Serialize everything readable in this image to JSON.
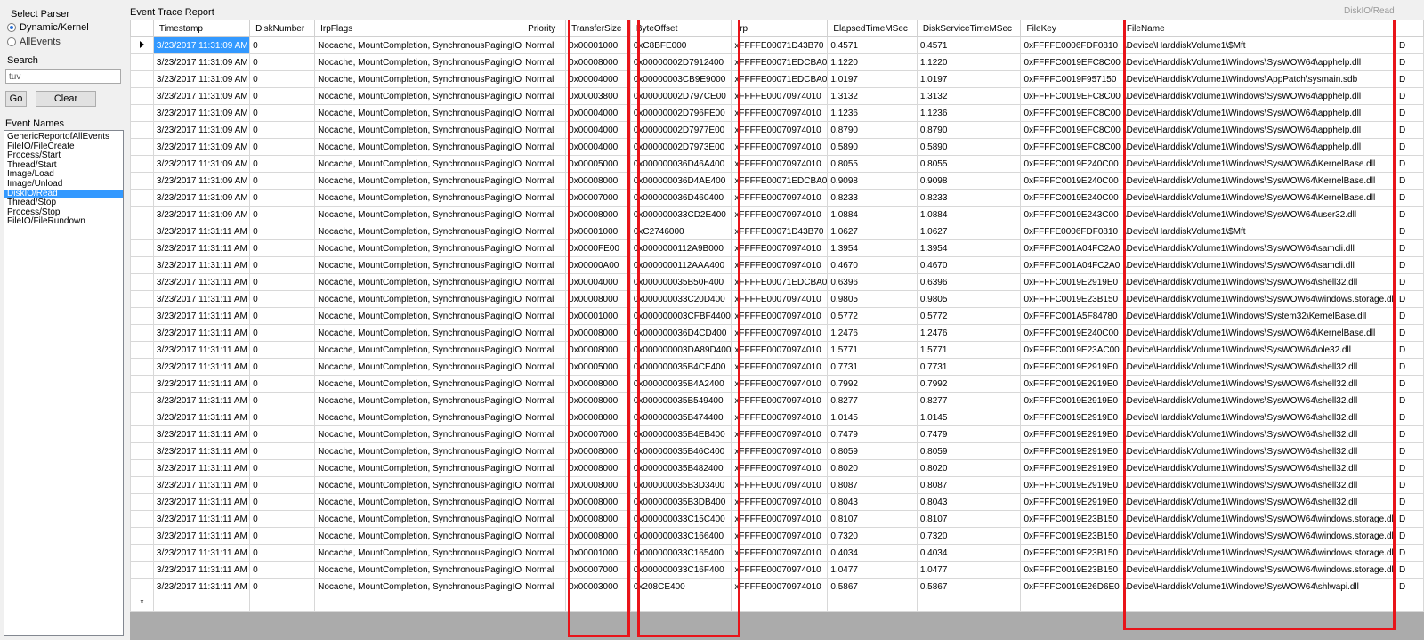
{
  "left": {
    "select_parser_label": "Select Parser",
    "radio_options": [
      {
        "label": "Dynamic/Kernel",
        "selected": true
      },
      {
        "label": "AllEvents",
        "selected": false
      }
    ],
    "search_label": "Search",
    "search_value": "tuv",
    "go_label": "Go",
    "clear_label": "Clear",
    "event_names_label": "Event Names",
    "event_names": [
      "GenericReportofAllEvents",
      "FileIO/FileCreate",
      "Process/Start",
      "Thread/Start",
      "Image/Load",
      "Image/Unload",
      "DiskIO/Read",
      "Thread/Stop",
      "Process/Stop",
      "FileIO/FileRundown"
    ],
    "selected_event": "DiskIO/Read"
  },
  "report": {
    "title": "Event Trace Report",
    "corner_text": "DiskIO/Read"
  },
  "columns": [
    "Timestamp",
    "DiskNumber",
    "IrpFlags",
    "Priority",
    "TransferSize",
    "ByteOffset",
    "Irp",
    "ElapsedTimeMSec",
    "DiskServiceTimeMSec",
    "FileKey",
    "FileName",
    ""
  ],
  "rows": [
    [
      "3/23/2017 11:31:09 AM",
      "0",
      "Nocache, MountCompletion, SynchronousPagingIO",
      "Normal",
      "0x00001000",
      "0xC8BFE000",
      "xFFFFE00071D43B70",
      "0.4571",
      "0.4571",
      "0xFFFFE0006FDF0810",
      "\\Device\\HarddiskVolume1\\$Mft",
      "D"
    ],
    [
      "3/23/2017 11:31:09 AM",
      "0",
      "Nocache, MountCompletion, SynchronousPagingIO",
      "Normal",
      "0x00008000",
      "0x00000002D7912400",
      "xFFFFE00071EDCBA0",
      "1.1220",
      "1.1220",
      "0xFFFFC0019EFC8C00",
      "\\Device\\HarddiskVolume1\\Windows\\SysWOW64\\apphelp.dll",
      "D"
    ],
    [
      "3/23/2017 11:31:09 AM",
      "0",
      "Nocache, MountCompletion, SynchronousPagingIO",
      "Normal",
      "0x00004000",
      "0x00000003CB9E9000",
      "xFFFFE00071EDCBA0",
      "1.0197",
      "1.0197",
      "0xFFFFC0019F957150",
      "\\Device\\HarddiskVolume1\\Windows\\AppPatch\\sysmain.sdb",
      "D"
    ],
    [
      "3/23/2017 11:31:09 AM",
      "0",
      "Nocache, MountCompletion, SynchronousPagingIO",
      "Normal",
      "0x00003800",
      "0x00000002D797CE00",
      "xFFFFE00070974010",
      "1.3132",
      "1.3132",
      "0xFFFFC0019EFC8C00",
      "\\Device\\HarddiskVolume1\\Windows\\SysWOW64\\apphelp.dll",
      "D"
    ],
    [
      "3/23/2017 11:31:09 AM",
      "0",
      "Nocache, MountCompletion, SynchronousPagingIO",
      "Normal",
      "0x00004000",
      "0x00000002D796FE00",
      "xFFFFE00070974010",
      "1.1236",
      "1.1236",
      "0xFFFFC0019EFC8C00",
      "\\Device\\HarddiskVolume1\\Windows\\SysWOW64\\apphelp.dll",
      "D"
    ],
    [
      "3/23/2017 11:31:09 AM",
      "0",
      "Nocache, MountCompletion, SynchronousPagingIO",
      "Normal",
      "0x00004000",
      "0x00000002D7977E00",
      "xFFFFE00070974010",
      "0.8790",
      "0.8790",
      "0xFFFFC0019EFC8C00",
      "\\Device\\HarddiskVolume1\\Windows\\SysWOW64\\apphelp.dll",
      "D"
    ],
    [
      "3/23/2017 11:31:09 AM",
      "0",
      "Nocache, MountCompletion, SynchronousPagingIO",
      "Normal",
      "0x00004000",
      "0x00000002D7973E00",
      "xFFFFE00070974010",
      "0.5890",
      "0.5890",
      "0xFFFFC0019EFC8C00",
      "\\Device\\HarddiskVolume1\\Windows\\SysWOW64\\apphelp.dll",
      "D"
    ],
    [
      "3/23/2017 11:31:09 AM",
      "0",
      "Nocache, MountCompletion, SynchronousPagingIO",
      "Normal",
      "0x00005000",
      "0x000000036D46A400",
      "xFFFFE00070974010",
      "0.8055",
      "0.8055",
      "0xFFFFC0019E240C00",
      "\\Device\\HarddiskVolume1\\Windows\\SysWOW64\\KernelBase.dll",
      "D"
    ],
    [
      "3/23/2017 11:31:09 AM",
      "0",
      "Nocache, MountCompletion, SynchronousPagingIO",
      "Normal",
      "0x00008000",
      "0x000000036D4AE400",
      "xFFFFE00071EDCBA0",
      "0.9098",
      "0.9098",
      "0xFFFFC0019E240C00",
      "\\Device\\HarddiskVolume1\\Windows\\SysWOW64\\KernelBase.dll",
      "D"
    ],
    [
      "3/23/2017 11:31:09 AM",
      "0",
      "Nocache, MountCompletion, SynchronousPagingIO",
      "Normal",
      "0x00007000",
      "0x000000036D460400",
      "xFFFFE00070974010",
      "0.8233",
      "0.8233",
      "0xFFFFC0019E240C00",
      "\\Device\\HarddiskVolume1\\Windows\\SysWOW64\\KernelBase.dll",
      "D"
    ],
    [
      "3/23/2017 11:31:09 AM",
      "0",
      "Nocache, MountCompletion, SynchronousPagingIO",
      "Normal",
      "0x00008000",
      "0x000000033CD2E400",
      "xFFFFE00070974010",
      "1.0884",
      "1.0884",
      "0xFFFFC0019E243C00",
      "\\Device\\HarddiskVolume1\\Windows\\SysWOW64\\user32.dll",
      "D"
    ],
    [
      "3/23/2017 11:31:11 AM",
      "0",
      "Nocache, MountCompletion, SynchronousPagingIO",
      "Normal",
      "0x00001000",
      "0xC2746000",
      "xFFFFE00071D43B70",
      "1.0627",
      "1.0627",
      "0xFFFFE0006FDF0810",
      "\\Device\\HarddiskVolume1\\$Mft",
      "D"
    ],
    [
      "3/23/2017 11:31:11 AM",
      "0",
      "Nocache, MountCompletion, SynchronousPagingIO",
      "Normal",
      "0x0000FE00",
      "0x0000000112A9B000",
      "xFFFFE00070974010",
      "1.3954",
      "1.3954",
      "0xFFFFC001A04FC2A0",
      "\\Device\\HarddiskVolume1\\Windows\\SysWOW64\\samcli.dll",
      "D"
    ],
    [
      "3/23/2017 11:31:11 AM",
      "0",
      "Nocache, MountCompletion, SynchronousPagingIO",
      "Normal",
      "0x00000A00",
      "0x0000000112AAA400",
      "xFFFFE00070974010",
      "0.4670",
      "0.4670",
      "0xFFFFC001A04FC2A0",
      "\\Device\\HarddiskVolume1\\Windows\\SysWOW64\\samcli.dll",
      "D"
    ],
    [
      "3/23/2017 11:31:11 AM",
      "0",
      "Nocache, MountCompletion, SynchronousPagingIO",
      "Normal",
      "0x00004000",
      "0x000000035B50F400",
      "xFFFFE00071EDCBA0",
      "0.6396",
      "0.6396",
      "0xFFFFC0019E2919E0",
      "\\Device\\HarddiskVolume1\\Windows\\SysWOW64\\shell32.dll",
      "D"
    ],
    [
      "3/23/2017 11:31:11 AM",
      "0",
      "Nocache, MountCompletion, SynchronousPagingIO",
      "Normal",
      "0x00008000",
      "0x000000033C20D400",
      "xFFFFE00070974010",
      "0.9805",
      "0.9805",
      "0xFFFFC0019E23B150",
      "\\Device\\HarddiskVolume1\\Windows\\SysWOW64\\windows.storage.dll",
      "D"
    ],
    [
      "3/23/2017 11:31:11 AM",
      "0",
      "Nocache, MountCompletion, SynchronousPagingIO",
      "Normal",
      "0x00001000",
      "0x000000003CFBF4400",
      "xFFFFE00070974010",
      "0.5772",
      "0.5772",
      "0xFFFFC001A5F84780",
      "\\Device\\HarddiskVolume1\\Windows\\System32\\KernelBase.dll",
      "D"
    ],
    [
      "3/23/2017 11:31:11 AM",
      "0",
      "Nocache, MountCompletion, SynchronousPagingIO",
      "Normal",
      "0x00008000",
      "0x000000036D4CD400",
      "xFFFFE00070974010",
      "1.2476",
      "1.2476",
      "0xFFFFC0019E240C00",
      "\\Device\\HarddiskVolume1\\Windows\\SysWOW64\\KernelBase.dll",
      "D"
    ],
    [
      "3/23/2017 11:31:11 AM",
      "0",
      "Nocache, MountCompletion, SynchronousPagingIO",
      "Normal",
      "0x00008000",
      "0x000000003DA89D400",
      "xFFFFE00070974010",
      "1.5771",
      "1.5771",
      "0xFFFFC0019E23AC00",
      "\\Device\\HarddiskVolume1\\Windows\\SysWOW64\\ole32.dll",
      "D"
    ],
    [
      "3/23/2017 11:31:11 AM",
      "0",
      "Nocache, MountCompletion, SynchronousPagingIO",
      "Normal",
      "0x00005000",
      "0x000000035B4CE400",
      "xFFFFE00070974010",
      "0.7731",
      "0.7731",
      "0xFFFFC0019E2919E0",
      "\\Device\\HarddiskVolume1\\Windows\\SysWOW64\\shell32.dll",
      "D"
    ],
    [
      "3/23/2017 11:31:11 AM",
      "0",
      "Nocache, MountCompletion, SynchronousPagingIO",
      "Normal",
      "0x00008000",
      "0x000000035B4A2400",
      "xFFFFE00070974010",
      "0.7992",
      "0.7992",
      "0xFFFFC0019E2919E0",
      "\\Device\\HarddiskVolume1\\Windows\\SysWOW64\\shell32.dll",
      "D"
    ],
    [
      "3/23/2017 11:31:11 AM",
      "0",
      "Nocache, MountCompletion, SynchronousPagingIO",
      "Normal",
      "0x00008000",
      "0x000000035B549400",
      "xFFFFE00070974010",
      "0.8277",
      "0.8277",
      "0xFFFFC0019E2919E0",
      "\\Device\\HarddiskVolume1\\Windows\\SysWOW64\\shell32.dll",
      "D"
    ],
    [
      "3/23/2017 11:31:11 AM",
      "0",
      "Nocache, MountCompletion, SynchronousPagingIO",
      "Normal",
      "0x00008000",
      "0x000000035B474400",
      "xFFFFE00070974010",
      "1.0145",
      "1.0145",
      "0xFFFFC0019E2919E0",
      "\\Device\\HarddiskVolume1\\Windows\\SysWOW64\\shell32.dll",
      "D"
    ],
    [
      "3/23/2017 11:31:11 AM",
      "0",
      "Nocache, MountCompletion, SynchronousPagingIO",
      "Normal",
      "0x00007000",
      "0x000000035B4EB400",
      "xFFFFE00070974010",
      "0.7479",
      "0.7479",
      "0xFFFFC0019E2919E0",
      "\\Device\\HarddiskVolume1\\Windows\\SysWOW64\\shell32.dll",
      "D"
    ],
    [
      "3/23/2017 11:31:11 AM",
      "0",
      "Nocache, MountCompletion, SynchronousPagingIO",
      "Normal",
      "0x00008000",
      "0x000000035B46C400",
      "xFFFFE00070974010",
      "0.8059",
      "0.8059",
      "0xFFFFC0019E2919E0",
      "\\Device\\HarddiskVolume1\\Windows\\SysWOW64\\shell32.dll",
      "D"
    ],
    [
      "3/23/2017 11:31:11 AM",
      "0",
      "Nocache, MountCompletion, SynchronousPagingIO",
      "Normal",
      "0x00008000",
      "0x000000035B482400",
      "xFFFFE00070974010",
      "0.8020",
      "0.8020",
      "0xFFFFC0019E2919E0",
      "\\Device\\HarddiskVolume1\\Windows\\SysWOW64\\shell32.dll",
      "D"
    ],
    [
      "3/23/2017 11:31:11 AM",
      "0",
      "Nocache, MountCompletion, SynchronousPagingIO",
      "Normal",
      "0x00008000",
      "0x000000035B3D3400",
      "xFFFFE00070974010",
      "0.8087",
      "0.8087",
      "0xFFFFC0019E2919E0",
      "\\Device\\HarddiskVolume1\\Windows\\SysWOW64\\shell32.dll",
      "D"
    ],
    [
      "3/23/2017 11:31:11 AM",
      "0",
      "Nocache, MountCompletion, SynchronousPagingIO",
      "Normal",
      "0x00008000",
      "0x000000035B3DB400",
      "xFFFFE00070974010",
      "0.8043",
      "0.8043",
      "0xFFFFC0019E2919E0",
      "\\Device\\HarddiskVolume1\\Windows\\SysWOW64\\shell32.dll",
      "D"
    ],
    [
      "3/23/2017 11:31:11 AM",
      "0",
      "Nocache, MountCompletion, SynchronousPagingIO",
      "Normal",
      "0x00008000",
      "0x000000033C15C400",
      "xFFFFE00070974010",
      "0.8107",
      "0.8107",
      "0xFFFFC0019E23B150",
      "\\Device\\HarddiskVolume1\\Windows\\SysWOW64\\windows.storage.dll",
      "D"
    ],
    [
      "3/23/2017 11:31:11 AM",
      "0",
      "Nocache, MountCompletion, SynchronousPagingIO",
      "Normal",
      "0x00008000",
      "0x000000033C166400",
      "xFFFFE00070974010",
      "0.7320",
      "0.7320",
      "0xFFFFC0019E23B150",
      "\\Device\\HarddiskVolume1\\Windows\\SysWOW64\\windows.storage.dll",
      "D"
    ],
    [
      "3/23/2017 11:31:11 AM",
      "0",
      "Nocache, MountCompletion, SynchronousPagingIO",
      "Normal",
      "0x00001000",
      "0x000000033C165400",
      "xFFFFE00070974010",
      "0.4034",
      "0.4034",
      "0xFFFFC0019E23B150",
      "\\Device\\HarddiskVolume1\\Windows\\SysWOW64\\windows.storage.dll",
      "D"
    ],
    [
      "3/23/2017 11:31:11 AM",
      "0",
      "Nocache, MountCompletion, SynchronousPagingIO",
      "Normal",
      "0x00007000",
      "0x000000033C16F400",
      "xFFFFE00070974010",
      "1.0477",
      "1.0477",
      "0xFFFFC0019E23B150",
      "\\Device\\HarddiskVolume1\\Windows\\SysWOW64\\windows.storage.dll",
      "D"
    ],
    [
      "3/23/2017 11:31:11 AM",
      "0",
      "Nocache, MountCompletion, SynchronousPagingIO",
      "Normal",
      "0x00003000",
      "0x208CE400",
      "xFFFFE00070974010",
      "0.5867",
      "0.5867",
      "0xFFFFC0019E26D6E0",
      "\\Device\\HarddiskVolume1\\Windows\\SysWOW64\\shlwapi.dll",
      "D"
    ]
  ],
  "current_row_marker": "▸",
  "new_row_marker": "*",
  "colors": {
    "highlight_box": "#e8141a",
    "selection": "#3399ff"
  }
}
